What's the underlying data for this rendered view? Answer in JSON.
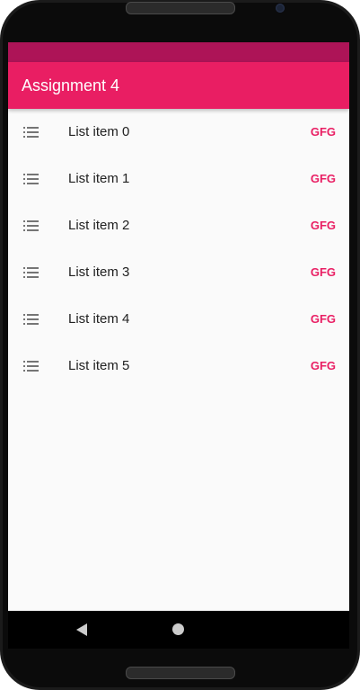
{
  "app": {
    "title": "Assignment 4"
  },
  "colors": {
    "primary": "#e91e63",
    "primary_dark": "#ad1457",
    "trailing_text": "#e91e63",
    "icon": "#757575"
  },
  "list": {
    "icon": "list-icon",
    "items": [
      {
        "label": "List item 0",
        "trailing": "GFG"
      },
      {
        "label": "List item 1",
        "trailing": "GFG"
      },
      {
        "label": "List item 2",
        "trailing": "GFG"
      },
      {
        "label": "List item 3",
        "trailing": "GFG"
      },
      {
        "label": "List item 4",
        "trailing": "GFG"
      },
      {
        "label": "List item 5",
        "trailing": "GFG"
      }
    ]
  },
  "nav": {
    "back_icon": "back-triangle-icon",
    "home_icon": "home-circle-icon"
  }
}
